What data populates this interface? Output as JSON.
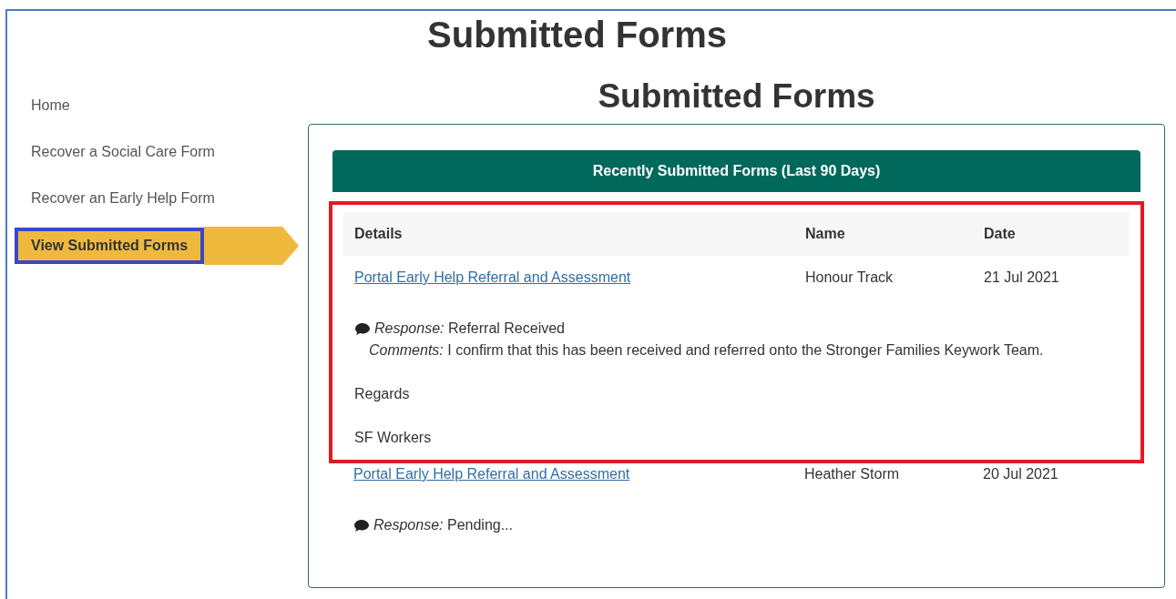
{
  "page_title": "Submitted Forms",
  "sidebar": {
    "items": [
      {
        "label": "Home",
        "selected": false,
        "highlighted": false
      },
      {
        "label": "Recover a Social Care Form",
        "selected": false,
        "highlighted": false
      },
      {
        "label": "Recover an Early Help Form",
        "selected": false,
        "highlighted": false
      },
      {
        "label": "View Submitted Forms",
        "selected": true,
        "highlighted": true
      }
    ]
  },
  "main": {
    "heading": "Submitted Forms",
    "panel_title": "Recently Submitted Forms (Last 90 Days)",
    "table": {
      "columns": [
        "Details",
        "Name",
        "Date"
      ],
      "rows": [
        {
          "form": "Portal Early Help Referral and Assessment",
          "name": "Honour Track",
          "date": "21 Jul 2021",
          "highlighted": true,
          "response_label": "Response:",
          "response": "Referral Received",
          "comments_label": "Comments:",
          "comments": "I confirm that this has been received and referred onto the Stronger Families Keywork Team.",
          "extra_lines": [
            "Regards",
            "SF Workers"
          ]
        },
        {
          "form": "Portal Early Help Referral and Assessment",
          "name": "Heather Storm",
          "date": "20 Jul 2021",
          "highlighted": false,
          "response_label": "Response:",
          "response": "Pending..."
        }
      ]
    }
  }
}
